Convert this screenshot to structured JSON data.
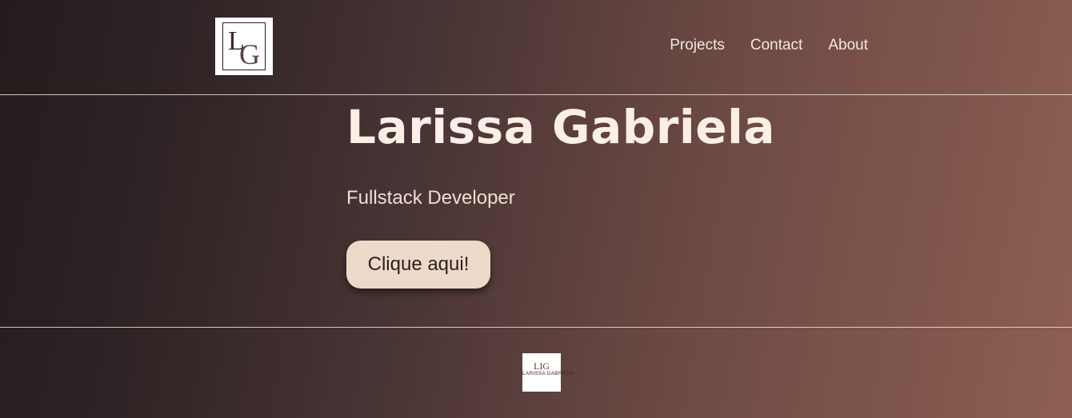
{
  "header": {
    "logo": {
      "letter_1": "L",
      "letter_2": "G"
    },
    "nav": [
      {
        "label": "Projects"
      },
      {
        "label": "Contact"
      },
      {
        "label": "About"
      }
    ]
  },
  "hero": {
    "title": "Larissa Gabriela",
    "subtitle": "Fullstack Developer",
    "button_label": "Clique aqui!"
  },
  "footer": {
    "logo": {
      "monogram": "LIG",
      "name": "LARISSA GABRIELA"
    }
  },
  "colors": {
    "gradient_start": "#261c1e",
    "gradient_end": "#8d5f52",
    "button_bg": "#eed9c8",
    "text_light": "#fbefe6"
  }
}
